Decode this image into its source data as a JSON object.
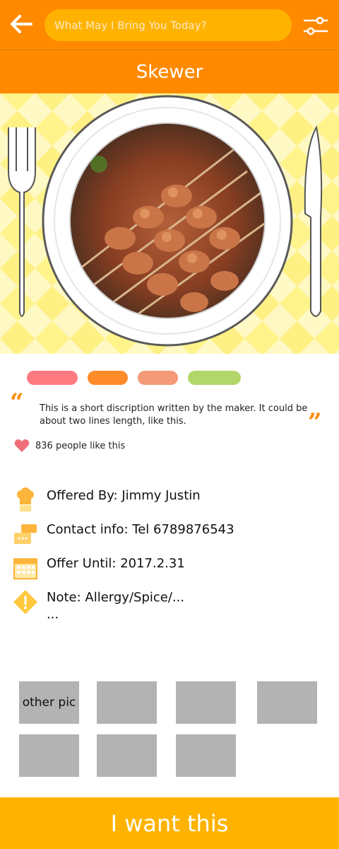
{
  "header": {
    "back_icon": "arrow-left-icon",
    "search_placeholder": "What May I Bring You Today?",
    "filter_icon": "sliders-icon"
  },
  "title": "Skewer",
  "tags": [
    {
      "color": "#ff7a80"
    },
    {
      "color": "#ff8a2a"
    },
    {
      "color": "#f49a78"
    },
    {
      "color": "#b3d66a"
    }
  ],
  "description": {
    "text": "This is a short discription written by the maker. It could be about two lines length, like this.",
    "open_quote": "“",
    "close_quote": "”"
  },
  "likes": {
    "icon": "heart-icon",
    "text": "836 people like this"
  },
  "info": {
    "offered_by": "Offered By: Jimmy Justin",
    "contact": "Contact info: Tel 6789876543",
    "offer_until": "Offer Until: 2017.2.31",
    "note_line1": "Note: Allergy/Spice/...",
    "note_line2": "..."
  },
  "gallery": {
    "first_label": "other pic"
  },
  "cta_label": "I want this",
  "colors": {
    "primary": "#ff8a00",
    "accent": "#ffb300"
  }
}
